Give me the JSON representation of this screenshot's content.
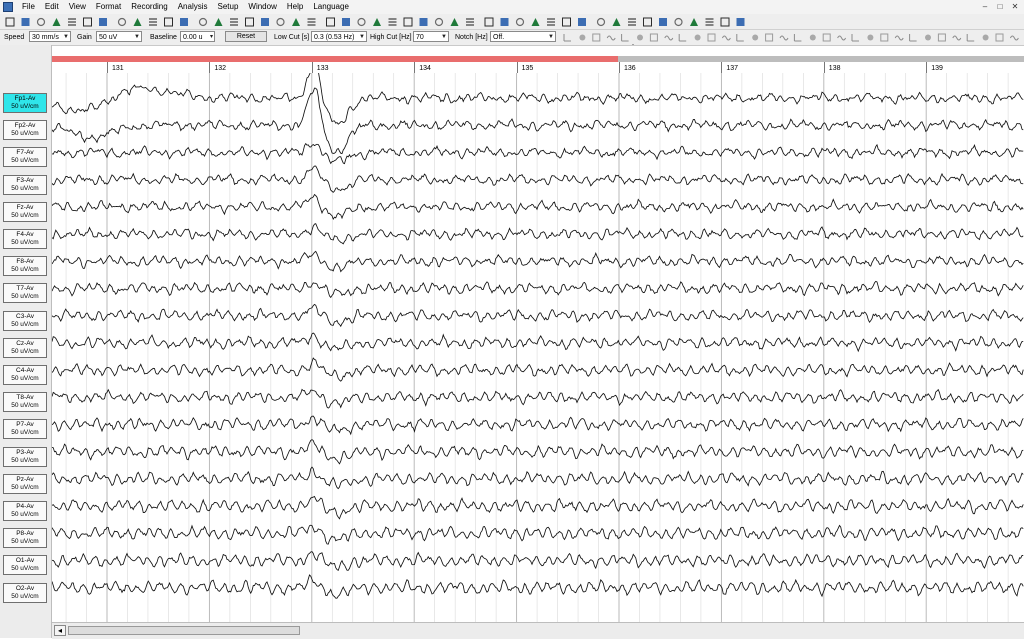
{
  "menu": [
    "File",
    "Edit",
    "View",
    "Format",
    "Recording",
    "Analysis",
    "Setup",
    "Window",
    "Help",
    "Language"
  ],
  "window_controls": [
    "–",
    "□",
    "✕"
  ],
  "toolbar": {
    "speed_label": "Speed",
    "speed_value": "30 mm/s",
    "gain_label": "Gain",
    "gain_value": "50 uV",
    "baseline_label": "Baseline",
    "baseline_value": "0.00 u",
    "reset_label": "Reset",
    "lowcut_label": "Low Cut [s]",
    "lowcut_value": "0.3  (0.53 Hz)",
    "highcut_label": "High Cut [Hz]",
    "highcut_value": "70",
    "notch_label": "Notch [Hz]",
    "notch_value": "Off."
  },
  "timeline": {
    "seconds": [
      "131",
      "132",
      "133",
      "134",
      "135",
      "136",
      "137",
      "138",
      "139"
    ]
  },
  "channels": [
    {
      "name": "Fp1-Av",
      "scale": "50 uV/cm",
      "active": true
    },
    {
      "name": "Fp2-Av",
      "scale": "50 uV/cm",
      "active": false
    },
    {
      "name": "F7-Av",
      "scale": "50 uV/cm",
      "active": false
    },
    {
      "name": "F3-Av",
      "scale": "50 uV/cm",
      "active": false
    },
    {
      "name": "Fz-Av",
      "scale": "50 uV/cm",
      "active": false
    },
    {
      "name": "F4-Av",
      "scale": "50 uV/cm",
      "active": false
    },
    {
      "name": "F8-Av",
      "scale": "50 uV/cm",
      "active": false
    },
    {
      "name": "T7-Av",
      "scale": "50 uV/cm",
      "active": false
    },
    {
      "name": "C3-Av",
      "scale": "50 uV/cm",
      "active": false
    },
    {
      "name": "Cz-Av",
      "scale": "50 uV/cm",
      "active": false
    },
    {
      "name": "C4-Av",
      "scale": "50 uV/cm",
      "active": false
    },
    {
      "name": "T8-Av",
      "scale": "50 uV/cm",
      "active": false
    },
    {
      "name": "P7-Av",
      "scale": "50 uV/cm",
      "active": false
    },
    {
      "name": "P3-Av",
      "scale": "50 uV/cm",
      "active": false
    },
    {
      "name": "Pz-Av",
      "scale": "50 uV/cm",
      "active": false
    },
    {
      "name": "P4-Av",
      "scale": "50 uV/cm",
      "active": false
    },
    {
      "name": "P8-Av",
      "scale": "50 uV/cm",
      "active": false
    },
    {
      "name": "O1-Av",
      "scale": "50 uV/cm",
      "active": false
    },
    {
      "name": "O2-Av",
      "scale": "50 uV/cm",
      "active": false
    }
  ],
  "colors": {
    "active_channel": "#2fe5ea",
    "played_bar": "#e96d6d",
    "trace": "#111111",
    "grid": "#c8c8c8"
  }
}
